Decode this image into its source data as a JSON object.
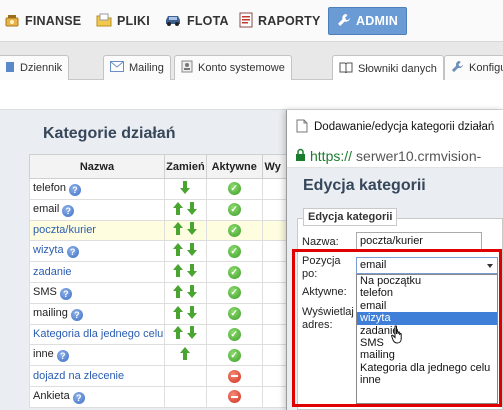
{
  "topnav": {
    "items": [
      {
        "label": "FINANSE",
        "icon": "money-icon"
      },
      {
        "label": "PLIKI",
        "icon": "folder-icon"
      },
      {
        "label": "FLOTA",
        "icon": "car-icon"
      },
      {
        "label": "RAPORTY",
        "icon": "report-icon"
      },
      {
        "label": "ADMIN",
        "icon": "wrench-icon",
        "active": true
      }
    ]
  },
  "tabs": [
    {
      "label": "Dziennik",
      "icon": "journal-icon"
    },
    {
      "label": "Mailing",
      "icon": "mail-icon"
    },
    {
      "label": "Konto systemowe",
      "icon": "account-icon"
    },
    {
      "label": "Słowniki danych",
      "icon": "book-icon",
      "active": true
    },
    {
      "label": "Konfigu",
      "icon": "wrench-icon"
    }
  ],
  "categories": {
    "title": "Kategorie działań",
    "columns": [
      "Nazwa",
      "Zamień",
      "Aktywne",
      "Wy"
    ],
    "rows": [
      {
        "name": "telefon",
        "help": true,
        "link": false,
        "move": "down",
        "active": true
      },
      {
        "name": "email",
        "help": true,
        "link": false,
        "move": "both",
        "active": true
      },
      {
        "name": "poczta/kurier",
        "help": false,
        "link": true,
        "move": "both",
        "active": true,
        "highlight": true
      },
      {
        "name": "wizyta",
        "help": true,
        "link": true,
        "move": "both",
        "active": true
      },
      {
        "name": "zadanie",
        "help": false,
        "link": true,
        "move": "both",
        "active": true
      },
      {
        "name": "SMS",
        "help": true,
        "link": false,
        "move": "both",
        "active": true
      },
      {
        "name": "mailing",
        "help": true,
        "link": false,
        "move": "both",
        "active": true
      },
      {
        "name": "Kategoria dla jednego celu",
        "help": false,
        "link": true,
        "move": "both",
        "active": true
      },
      {
        "name": "inne",
        "help": true,
        "link": false,
        "move": "up",
        "active": true
      },
      {
        "name": "dojazd na zlecenie",
        "help": false,
        "link": true,
        "move": "none",
        "active": false
      },
      {
        "name": "Ankieta",
        "help": true,
        "link": false,
        "move": "none",
        "active": false
      }
    ]
  },
  "popup": {
    "window_title": "Dodawanie/edycja kategorii działań",
    "url_scheme": "https://",
    "url_host": "serwer10.crmvision-",
    "heading": "Edycja kategorii",
    "legend": "Edycja kategorii",
    "labels": {
      "nazwa": "Nazwa:",
      "pozycja_line1": "Pozycja",
      "pozycja_line2": "po:",
      "aktywne": "Aktywne:",
      "wyswietlaj_line1": "Wyświetlaj",
      "wyswietlaj_line2": "adres:"
    },
    "nazwa_value": "poczta/kurier",
    "pozycja_selected": "email",
    "dropdown_options": [
      "Na początku",
      "telefon",
      "email",
      "wizyta",
      "zadanie",
      "SMS",
      "mailing",
      "Kategoria dla jednego celu",
      "inne"
    ],
    "dropdown_highlighted": "wizyta"
  },
  "colors": {
    "accent": "#6a9bd4",
    "highlight_row": "#fffde0",
    "annotation_red": "#e00000",
    "selection_blue": "#3f7fd8"
  }
}
